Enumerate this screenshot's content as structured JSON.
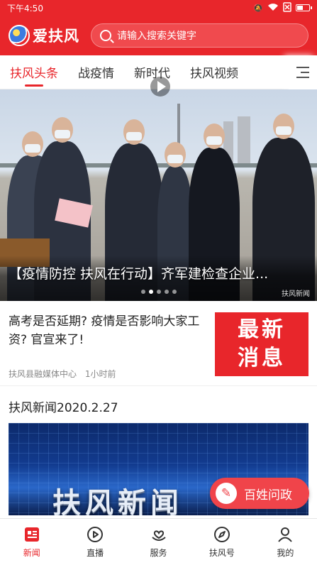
{
  "status_bar": {
    "time": "下午4:50",
    "signal_icon": "mute-icon",
    "wifi_icon": "wifi-icon",
    "sim_icon": "no-sim-icon",
    "battery_level": 0.55
  },
  "header": {
    "logo_text": "爱扶风",
    "search_placeholder": "请输入搜索关键字",
    "brand_color": "#e8262b"
  },
  "tabs": [
    {
      "label": "扶风头条",
      "active": true
    },
    {
      "label": "战疫情",
      "active": false
    },
    {
      "label": "新时代",
      "active": false
    },
    {
      "label": "扶风视频",
      "active": false
    }
  ],
  "banner": {
    "title": "【疫情防控 扶风在行动】齐军建检查企业...",
    "slides": 5,
    "active_slide": 1,
    "watermark": "扶风新闻"
  },
  "news": [
    {
      "title": "高考是否延期? 疫情是否影响大家工资? 官宣来了!",
      "source": "扶风县融媒体中心",
      "time": "1小时前",
      "thumb_line1": "最新",
      "thumb_line2": "消息"
    },
    {
      "title": "扶风新闻2020.2.27",
      "thumb_text": "扶风新闻"
    }
  ],
  "float_button": {
    "label": "百姓问政",
    "icon": "edit-icon"
  },
  "bottom_nav": [
    {
      "label": "新闻",
      "icon": "news-icon",
      "active": true
    },
    {
      "label": "直播",
      "icon": "play-circle-icon",
      "active": false
    },
    {
      "label": "服务",
      "icon": "heart-hand-icon",
      "active": false
    },
    {
      "label": "扶风号",
      "icon": "compass-icon",
      "active": false
    },
    {
      "label": "我的",
      "icon": "user-icon",
      "active": false
    }
  ]
}
